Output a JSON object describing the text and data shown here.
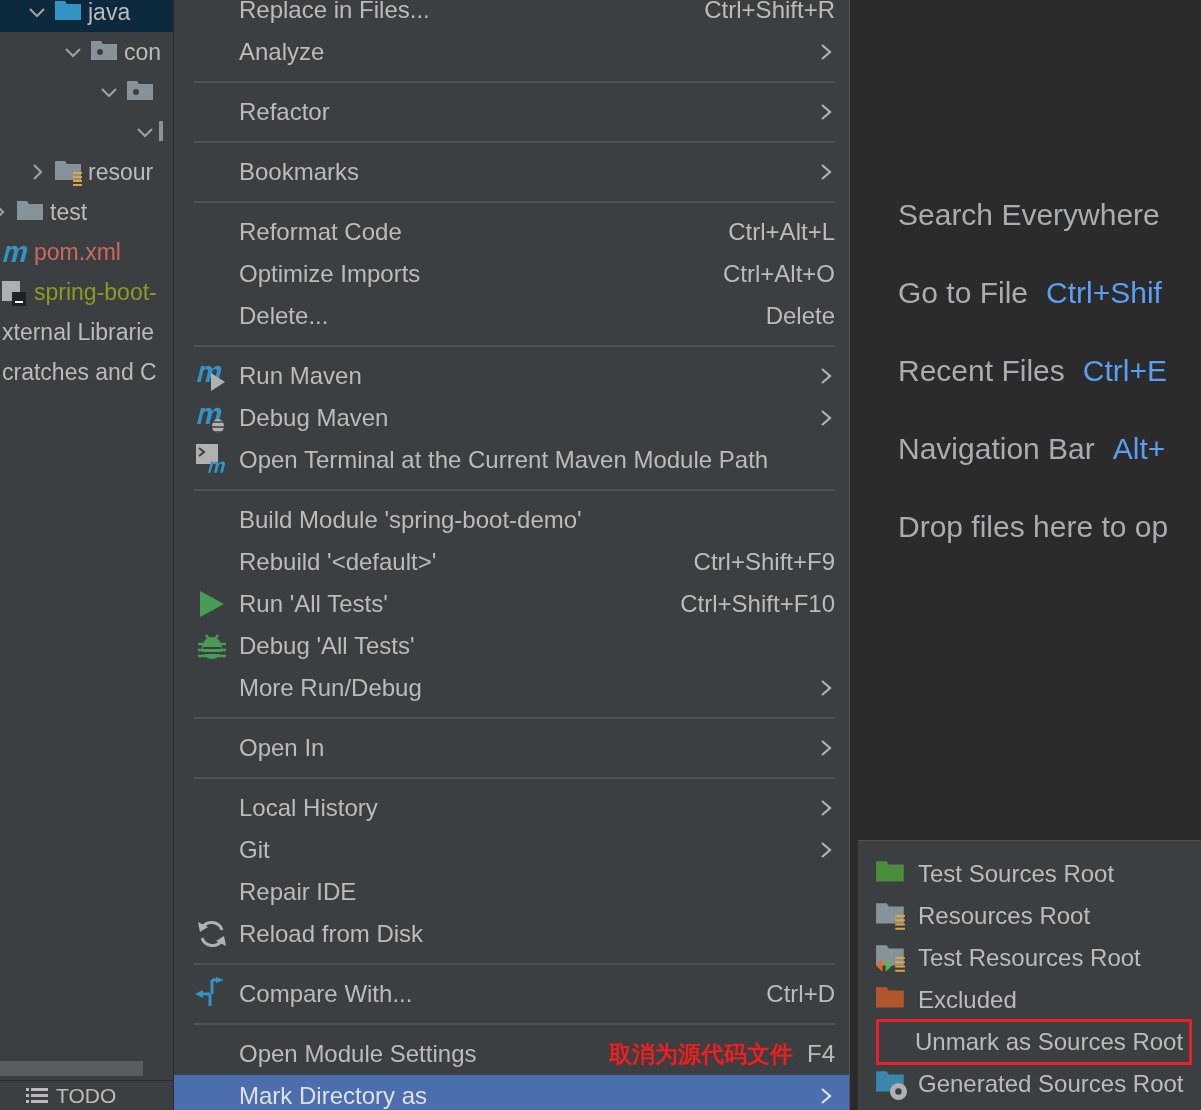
{
  "project_tree": {
    "items": [
      {
        "label": "java",
        "kind": "source",
        "expanded": true,
        "selected": true,
        "children": [
          {
            "label": "con",
            "kind": "package",
            "expanded": true,
            "selected": false,
            "children": [
              {
                "kind": "package",
                "expanded": true,
                "selected": false,
                "children": [
                  {
                    "kind": "cut",
                    "expanded": true,
                    "selected": false
                  }
                ]
              }
            ]
          }
        ]
      },
      {
        "label": "resour",
        "kind": "resources",
        "expanded": false,
        "selected": false
      }
    ],
    "root_items": [
      {
        "label": "test",
        "kind": "folder",
        "expanded": false,
        "color": "#bbbbbb"
      },
      {
        "label": "pom.xml",
        "kind": "maven",
        "color": "#d1675a"
      },
      {
        "label": "spring-boot-",
        "kind": "module",
        "color": "#8f9a22"
      },
      {
        "label": "xternal Librarie",
        "kind": "plain",
        "color": "#bbbbbb"
      },
      {
        "label": "cratches and C",
        "kind": "plain",
        "color": "#bbbbbb"
      }
    ]
  },
  "bottom_bar": {
    "tool_window": "TODO"
  },
  "context_menu": [
    {
      "kind": "plain",
      "label": "Replace in Files...",
      "shortcut": "Ctrl+Shift+R",
      "submenu": false,
      "selected": false
    },
    {
      "kind": "plain",
      "label": "Analyze",
      "submenu": true,
      "selected": false
    },
    {
      "kind": "separator"
    },
    {
      "kind": "plain",
      "label": "Refactor",
      "submenu": true,
      "selected": false
    },
    {
      "kind": "separator"
    },
    {
      "kind": "plain",
      "label": "Bookmarks",
      "submenu": true,
      "selected": false
    },
    {
      "kind": "separator"
    },
    {
      "kind": "plain",
      "label": "Reformat Code",
      "shortcut": "Ctrl+Alt+L",
      "submenu": false,
      "selected": false
    },
    {
      "kind": "plain",
      "label": "Optimize Imports",
      "shortcut": "Ctrl+Alt+O",
      "submenu": false,
      "selected": false
    },
    {
      "kind": "plain",
      "label": "Delete...",
      "shortcut": "Delete",
      "submenu": false,
      "selected": false
    },
    {
      "kind": "separator"
    },
    {
      "kind": "mavenrun",
      "label": "Run Maven",
      "submenu": true,
      "selected": false
    },
    {
      "kind": "mavendebug",
      "label": "Debug Maven",
      "submenu": true,
      "selected": false
    },
    {
      "kind": "terminal",
      "label": "Open Terminal at the Current Maven Module Path",
      "submenu": false,
      "selected": false
    },
    {
      "kind": "separator"
    },
    {
      "kind": "plain",
      "label": "Build Module 'spring-boot-demo'",
      "submenu": false,
      "selected": false
    },
    {
      "kind": "plain",
      "label": "Rebuild '<default>'",
      "shortcut": "Ctrl+Shift+F9",
      "submenu": false,
      "selected": false
    },
    {
      "kind": "run",
      "label": "Run 'All Tests'",
      "shortcut": "Ctrl+Shift+F10",
      "submenu": false,
      "selected": false
    },
    {
      "kind": "debug",
      "label": "Debug 'All Tests'",
      "submenu": false,
      "selected": false
    },
    {
      "kind": "plain",
      "label": "More Run/Debug",
      "submenu": true,
      "selected": false
    },
    {
      "kind": "separator"
    },
    {
      "kind": "plain",
      "label": "Open In",
      "submenu": true,
      "selected": false
    },
    {
      "kind": "separator"
    },
    {
      "kind": "plain",
      "label": "Local History",
      "submenu": true,
      "selected": false
    },
    {
      "kind": "plain",
      "label": "Git",
      "submenu": true,
      "selected": false
    },
    {
      "kind": "plain",
      "label": "Repair IDE",
      "submenu": false,
      "selected": false
    },
    {
      "kind": "reload",
      "label": "Reload from Disk",
      "submenu": false,
      "selected": false
    },
    {
      "kind": "separator"
    },
    {
      "kind": "compare",
      "label": "Compare With...",
      "shortcut": "Ctrl+D",
      "submenu": false,
      "selected": false
    },
    {
      "kind": "separator"
    },
    {
      "kind": "plain",
      "label": "Open Module Settings",
      "annotation": "取消为源代码文件",
      "shortcut": "F4",
      "submenu": false,
      "selected": false
    },
    {
      "kind": "plain",
      "label": "Mark Directory as",
      "submenu": true,
      "selected": true
    }
  ],
  "editor_hints": [
    {
      "action": "Search Everywhere"
    },
    {
      "action": "Go to File",
      "shortcut": "Ctrl+Shif"
    },
    {
      "action": "Recent Files",
      "shortcut": "Ctrl+E"
    },
    {
      "action": "Navigation Bar",
      "shortcut": "Alt+"
    },
    {
      "action": "Drop files here to op"
    }
  ],
  "submenu": [
    {
      "label": "Test Sources Root",
      "kind": "testsources",
      "highlighted": false
    },
    {
      "label": "Resources Root",
      "kind": "resources",
      "highlighted": false
    },
    {
      "label": "Test Resources Root",
      "kind": "testresources",
      "highlighted": false
    },
    {
      "label": "Excluded",
      "kind": "excluded",
      "highlighted": false
    },
    {
      "label": "Unmark as Sources Root",
      "kind": "plain",
      "highlighted": true
    },
    {
      "label": "Generated Sources Root",
      "kind": "generated",
      "highlighted": false
    }
  ]
}
